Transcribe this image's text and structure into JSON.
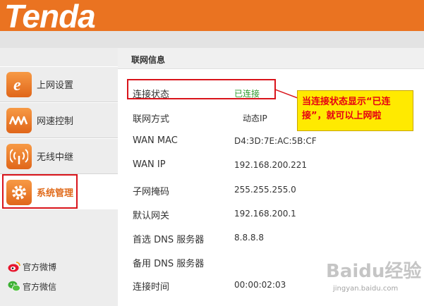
{
  "brand": {
    "logo_text": "Tenda",
    "accent": "#ea7321"
  },
  "sidebar": {
    "items": [
      {
        "label": "上网设置",
        "icon": "internet-e-icon"
      },
      {
        "label": "网速控制",
        "icon": "speed-wave-icon"
      },
      {
        "label": "无线中继",
        "icon": "wireless-signal-icon"
      },
      {
        "label": "系统管理",
        "icon": "gear-icon",
        "active": true
      }
    ],
    "social": [
      {
        "label": "官方微博",
        "icon": "weibo-icon"
      },
      {
        "label": "官方微信",
        "icon": "wechat-icon"
      }
    ]
  },
  "main": {
    "title": "联网信息",
    "rows": [
      {
        "label": "连接状态",
        "value": "已连接",
        "status_color": "#2e9a2e"
      },
      {
        "label": "联网方式",
        "value": "动态IP"
      },
      {
        "label": "WAN MAC",
        "value": "D4:3D:7E:AC:5B:CF"
      },
      {
        "label": "WAN IP",
        "value": "192.168.200.221"
      },
      {
        "label": "子网掩码",
        "value": "255.255.255.0"
      },
      {
        "label": "默认网关",
        "value": "192.168.200.1"
      },
      {
        "label": "首选 DNS 服务器",
        "value": "8.8.8.8"
      },
      {
        "label": "备用 DNS 服务器",
        "value": ""
      },
      {
        "label": "连接时间",
        "value": "00:00:02:03"
      }
    ]
  },
  "annotation": {
    "callout_line1": "当连接状态显示“已连",
    "callout_line2": "接”，就可以上网啦"
  },
  "watermark": {
    "text": "Baidu经验",
    "url": "jingyan.baidu.com"
  }
}
